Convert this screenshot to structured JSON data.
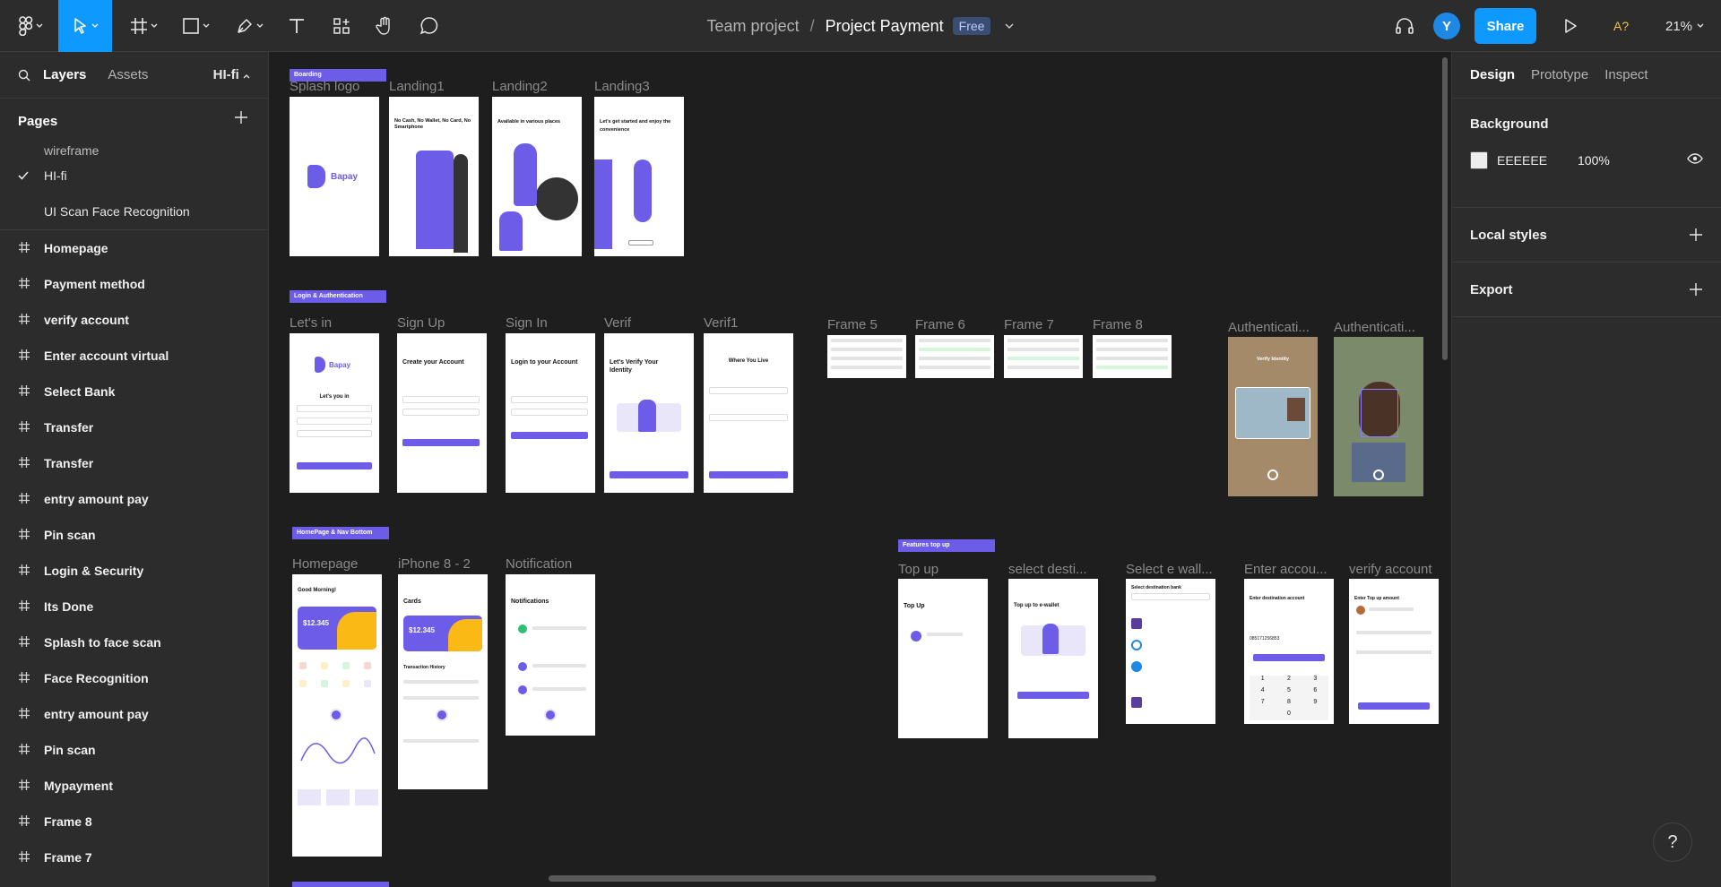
{
  "toolbar": {
    "tools": [
      "main-menu",
      "move",
      "frame",
      "shape",
      "pen",
      "text",
      "resources",
      "hand",
      "comment"
    ]
  },
  "title": {
    "team": "Team project",
    "separator": "/",
    "file": "Project Payment",
    "plan_badge": "Free"
  },
  "topright": {
    "avatar_letter": "Y",
    "share_label": "Share",
    "font_warning": "A?",
    "zoom": "21%"
  },
  "left_panel": {
    "tabs": {
      "layers": "Layers",
      "assets": "Assets"
    },
    "current_page": "HI-fi",
    "pages_heading": "Pages",
    "pages": [
      "wireframe",
      "HI-fi",
      "UI Scan Face Recognition"
    ],
    "layers": [
      "Homepage",
      "Payment method",
      "verify account",
      "Enter account virtual",
      "Select Bank",
      "Transfer",
      "Transfer",
      "entry amount pay",
      "Pin scan",
      "Login & Security",
      "Its Done",
      "Splash to face scan",
      "Face Recognition",
      "entry amount pay",
      "Pin scan",
      "Mypayment",
      "Frame 8",
      "Frame 7"
    ]
  },
  "canvas": {
    "sections": {
      "boarding": "Boarding",
      "login": "Login & Authentication",
      "homepage": "HomePage & Nav Bottom",
      "topup": "Features top up"
    },
    "frame_labels": {
      "splash": "Splash logo",
      "landing1": "Landing1",
      "landing2": "Landing2",
      "landing3": "Landing3",
      "letsin": "Let's in",
      "signup": "Sign Up",
      "signin": "Sign In",
      "verif": "Verif",
      "verif1": "Verif1",
      "frame5": "Frame 5",
      "frame6": "Frame 6",
      "frame7": "Frame 7",
      "frame8": "Frame 8",
      "auth1": "Authenticati...",
      "auth2": "Authenticati...",
      "homepage": "Homepage",
      "iphone": "iPhone 8 - 2",
      "notification": "Notification",
      "topup": "Top up",
      "selectdest": "select desti...",
      "selectewallet": "Select e wall...",
      "enteraccount": "Enter accou...",
      "verifyaccount": "verify account"
    },
    "frame_text": {
      "brand": "Bapay",
      "landing1_title": "No Cash, No Wallet, No Card, No Smartphone",
      "landing2_title": "Available in various places",
      "landing3_title": "Let's get started and enjoy the convenience",
      "letsin_title": "Let's you in",
      "signup_title": "Create your Account",
      "signin_title": "Login to your Account",
      "verif_title": "Let's Verify Your Identity",
      "verif1_title": "Where You Live",
      "verify_identity": "Verify Identity",
      "greeting": "Good Morning!",
      "balance": "$12.345",
      "cards_title": "Cards",
      "transaction_history": "Transaction History",
      "notifications_title": "Notifications",
      "topup_title": "Top Up",
      "topup_ewallet": "Top up to e-wallet",
      "select_bank": "Select destination bank",
      "enter_dest": "Enter destination account",
      "account_number": "085171256853",
      "enter_topup": "Enter Top up amount",
      "keypad": [
        "1",
        "2",
        "3",
        "4",
        "5",
        "6",
        "7",
        "8",
        "9",
        "",
        "0",
        ""
      ]
    }
  },
  "right_panel": {
    "tabs": {
      "design": "Design",
      "prototype": "Prototype",
      "inspect": "Inspect"
    },
    "background": {
      "label": "Background",
      "hex": "EEEEEE",
      "opacity": "100%",
      "color": "#eeeeee"
    },
    "local_styles": "Local styles",
    "export": "Export"
  },
  "help": "?",
  "colors": {
    "accent": "#0d99ff",
    "brand_purple": "#6c5ce7",
    "canvas": "#1e1e1e",
    "panel": "#2c2c2c"
  }
}
